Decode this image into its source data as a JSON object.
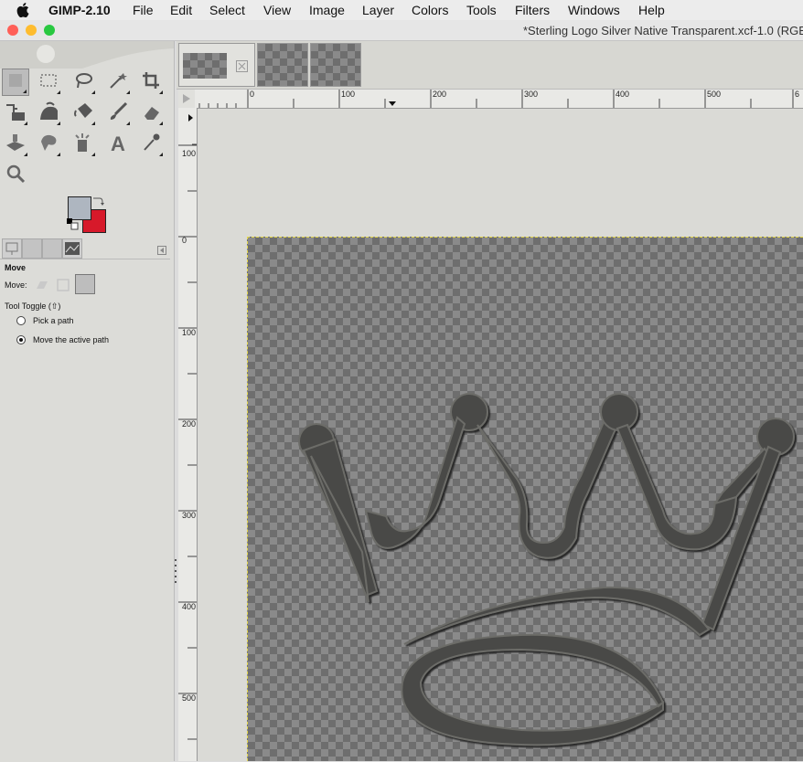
{
  "menubar": {
    "app_name": "GIMP-2.10",
    "items": [
      "File",
      "Edit",
      "Select",
      "View",
      "Image",
      "Layer",
      "Colors",
      "Tools",
      "Filters",
      "Windows",
      "Help"
    ]
  },
  "window": {
    "title": "*Sterling Logo Silver Native Transparent.xcf-1.0 (RGB",
    "traffic_lights": [
      "#ff5f57",
      "#febc2e",
      "#28c840"
    ]
  },
  "toolbox": {
    "tools": [
      "move-tool-icon",
      "rect-select-icon",
      "free-select-icon",
      "fuzzy-select-icon",
      "crop-icon",
      "unified-transform-icon",
      "warp-transform-icon",
      "bucket-fill-icon",
      "paintbrush-icon",
      "eraser-icon",
      "clone-icon",
      "smudge-icon",
      "dodge-burn-icon",
      "text-icon",
      "color-picker-icon",
      "zoom-icon"
    ],
    "fg_color": "#aeb6c0",
    "bg_color": "#d7192a"
  },
  "tool_options": {
    "title": "Move",
    "move_label": "Move:",
    "tool_toggle": "Tool Toggle  (⇧)",
    "options": [
      {
        "label": "Pick a path",
        "selected": false
      },
      {
        "label": "Move the active path",
        "selected": true
      }
    ]
  },
  "rulers": {
    "h_labels": [
      "0",
      "100",
      "200",
      "300",
      "400",
      "500",
      "6"
    ],
    "v_labels": [
      "0",
      "100",
      "200",
      "300",
      "400",
      "500"
    ],
    "v_neg_label": "100"
  }
}
